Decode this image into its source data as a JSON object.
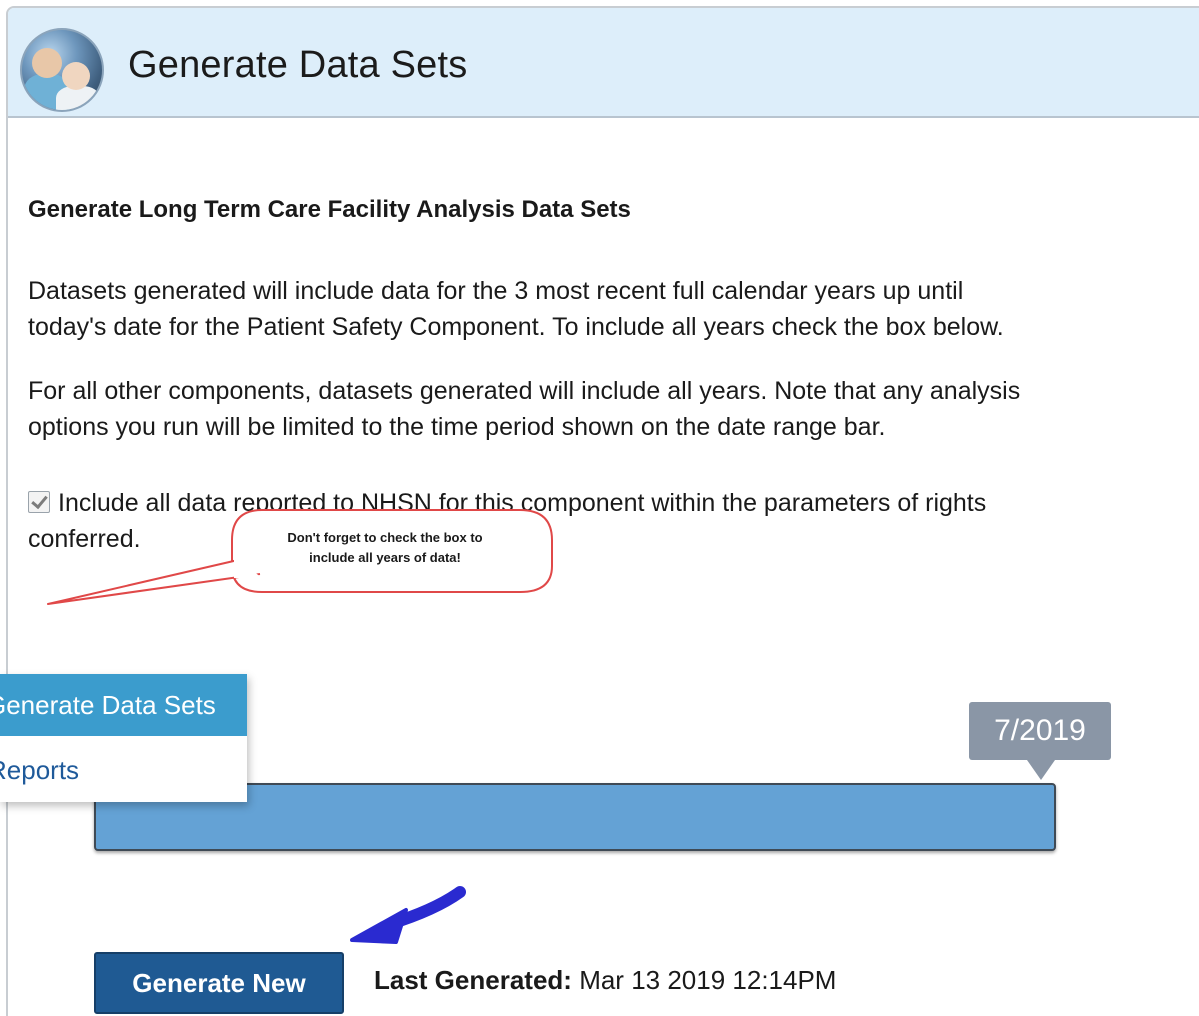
{
  "header": {
    "title": "Generate Data Sets"
  },
  "main": {
    "section_title": "Generate Long Term Care Facility Analysis Data Sets",
    "paragraph1": "Datasets generated will include data for the 3 most recent full calendar years up until today's date for the Patient Safety Component. To include all years check the box below.",
    "paragraph2": "For all other components, datasets generated will include all years. Note that any analysis options you run will be limited to the time period shown on the date range bar.",
    "checkbox": {
      "label": "Include all data reported to NHSN for this component within the parameters of rights conferred.",
      "checked": true
    },
    "callout": {
      "line1": "Don't forget to check the box to",
      "line2": "include all years of data!"
    }
  },
  "menu": {
    "items": [
      {
        "label": "Generate Data Sets",
        "active": true
      },
      {
        "label": "Reports",
        "active": false
      }
    ]
  },
  "date_range": {
    "end_label": "7/2019",
    "bar_color": "#64a2d5"
  },
  "footer": {
    "button_label": "Generate New",
    "last_generated_label": "Last Generated:",
    "last_generated_value": "Mar 13 2019 12:14PM"
  },
  "colors": {
    "header_bg": "#ddeefa",
    "menu_active_bg": "#3b9ccd",
    "button_bg": "#1f5a93",
    "callout_border": "#e04848",
    "arrow": "#2a2ad0"
  }
}
